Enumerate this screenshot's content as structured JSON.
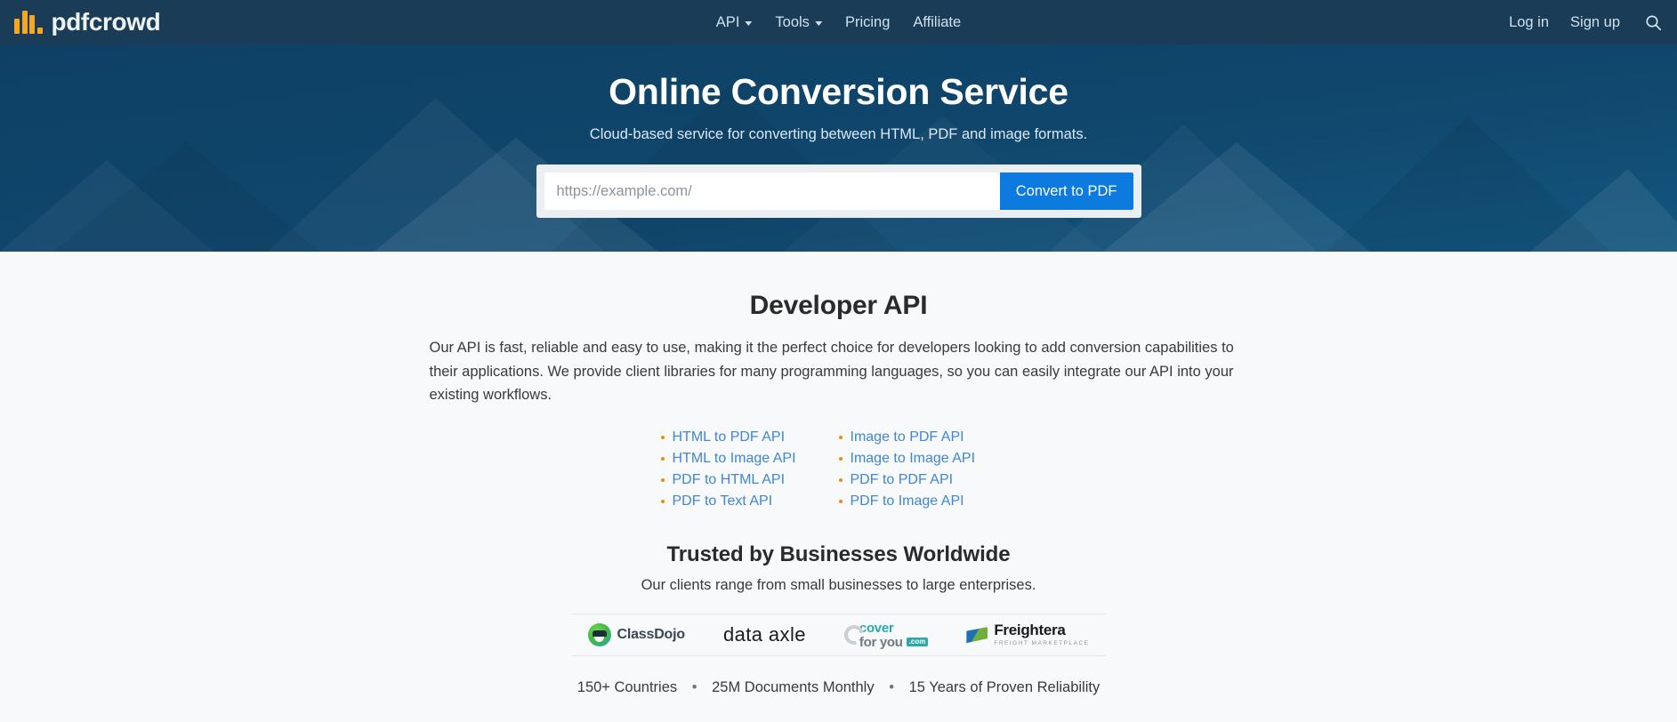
{
  "navbar": {
    "brand": "pdfcrowd",
    "logo_color": "#f5a623",
    "background": "#1a3c56",
    "center_items": [
      {
        "label": "API",
        "has_caret": true
      },
      {
        "label": "Tools",
        "has_caret": true
      },
      {
        "label": "Pricing",
        "has_caret": false
      },
      {
        "label": "Affiliate",
        "has_caret": false
      }
    ],
    "right_items": [
      {
        "label": "Log in"
      },
      {
        "label": "Sign up"
      }
    ],
    "search_icon": "search-icon"
  },
  "hero": {
    "title": "Online Conversion Service",
    "subtitle": "Cloud-based service for converting between HTML, PDF and image formats.",
    "url_value": "",
    "url_placeholder": "https://example.com/",
    "convert_button": "Convert to PDF",
    "accent": "#0d7ae0"
  },
  "api_section": {
    "title": "Developer API",
    "description": "Our API is fast, reliable and easy to use, making it the perfect choice for developers looking to add conversion capabilities to their applications. We provide client libraries for many programming languages, so you can easily integrate our API into your existing workflows.",
    "links": [
      "HTML to PDF API",
      "Image to PDF API",
      "HTML to Image API",
      "Image to Image API",
      "PDF to HTML API",
      "PDF to PDF API",
      "PDF to Text API",
      "PDF to Image API"
    ],
    "link_color": "#3f86d6",
    "bullet_color": "#e98a1f"
  },
  "trusted": {
    "title": "Trusted by Businesses Worldwide",
    "subtitle": "Our clients range from small businesses to large enterprises.",
    "logos": [
      {
        "name": "ClassDojo",
        "text": "ClassDojo"
      },
      {
        "name": "data axle",
        "text": "data axle"
      },
      {
        "name": "coverforyou.com",
        "line1": "cover",
        "line2": "for you",
        "badge": ".com"
      },
      {
        "name": "Freightera",
        "line1": "Freightera",
        "line2": "FREIGHT MARKETPLACE"
      }
    ],
    "stats": [
      "150+ Countries",
      "25M Documents Monthly",
      "15 Years of Proven Reliability"
    ],
    "stat_separator": "•"
  }
}
